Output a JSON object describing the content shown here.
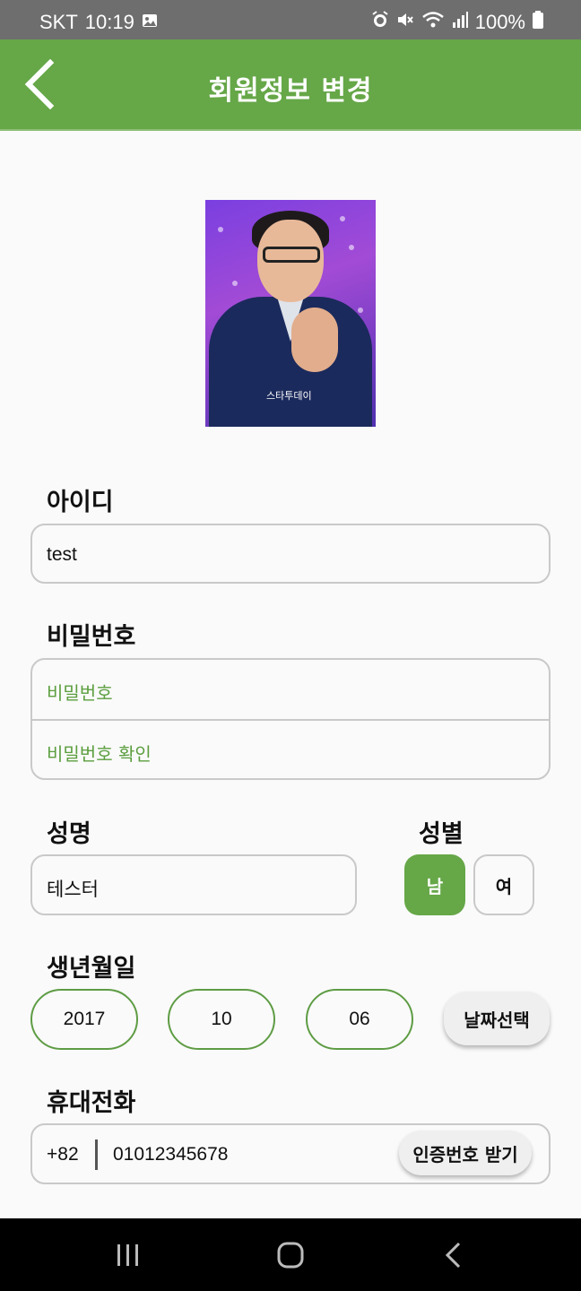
{
  "status_bar": {
    "carrier": "SKT",
    "time": "10:19",
    "battery": "100%",
    "icons": [
      "image-icon",
      "alarm-icon",
      "mute-icon",
      "wifi-icon",
      "signal-icon",
      "battery-icon"
    ]
  },
  "app_bar": {
    "title": "회원정보 변경",
    "back_icon": "chevron-left-icon"
  },
  "profile_photo": {
    "logo_text": "스타투데이"
  },
  "id_section": {
    "label": "아이디",
    "value": "test"
  },
  "password_section": {
    "label": "비밀번호",
    "password_placeholder": "비밀번호",
    "confirm_placeholder": "비밀번호 확인"
  },
  "name_section": {
    "label": "성명",
    "value": "테스터"
  },
  "gender_section": {
    "label": "성별",
    "male": "남",
    "female": "여",
    "selected": "남"
  },
  "birth_section": {
    "label": "생년월일",
    "year": "2017",
    "month": "10",
    "day": "06",
    "pick_button": "날짜선택"
  },
  "phone_section": {
    "label": "휴대전화",
    "country_code": "+82",
    "number": "01012345678",
    "verify_button": "인증번호 받기"
  },
  "colors": {
    "primary": "#66a748",
    "status_bar": "#6e6e6e",
    "border": "#c9c9c9",
    "placeholder": "#5b9e3e"
  },
  "nav_bar": {
    "icons": [
      "recent-apps-icon",
      "home-icon",
      "back-icon"
    ]
  }
}
